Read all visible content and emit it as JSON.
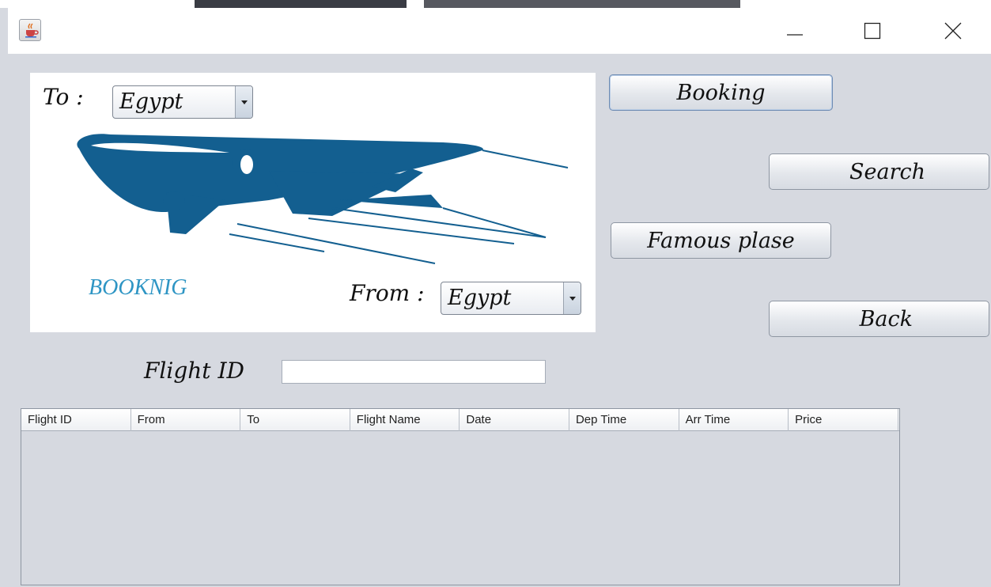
{
  "window": {
    "icon": "java-cup-icon",
    "controls": [
      "minimize-icon",
      "maximize-icon",
      "close-icon"
    ]
  },
  "logo": {
    "brand_text": "BOOKNIG",
    "to_label": "To :",
    "from_label": "From :",
    "to_value": "Egypt",
    "from_value": "Egypt",
    "plane_color": "#135f90",
    "brand_color": "#2e95c4"
  },
  "buttons": {
    "booking": "Booking",
    "search": "Search",
    "famous": "Famous plase",
    "back": "Back"
  },
  "flight_id": {
    "label": "Flight ID",
    "value": ""
  },
  "table": {
    "columns": [
      "Flight ID",
      "From",
      "To",
      "Flight Name",
      "Date",
      "Dep Time",
      "Arr Time",
      "Price"
    ],
    "rows": []
  }
}
